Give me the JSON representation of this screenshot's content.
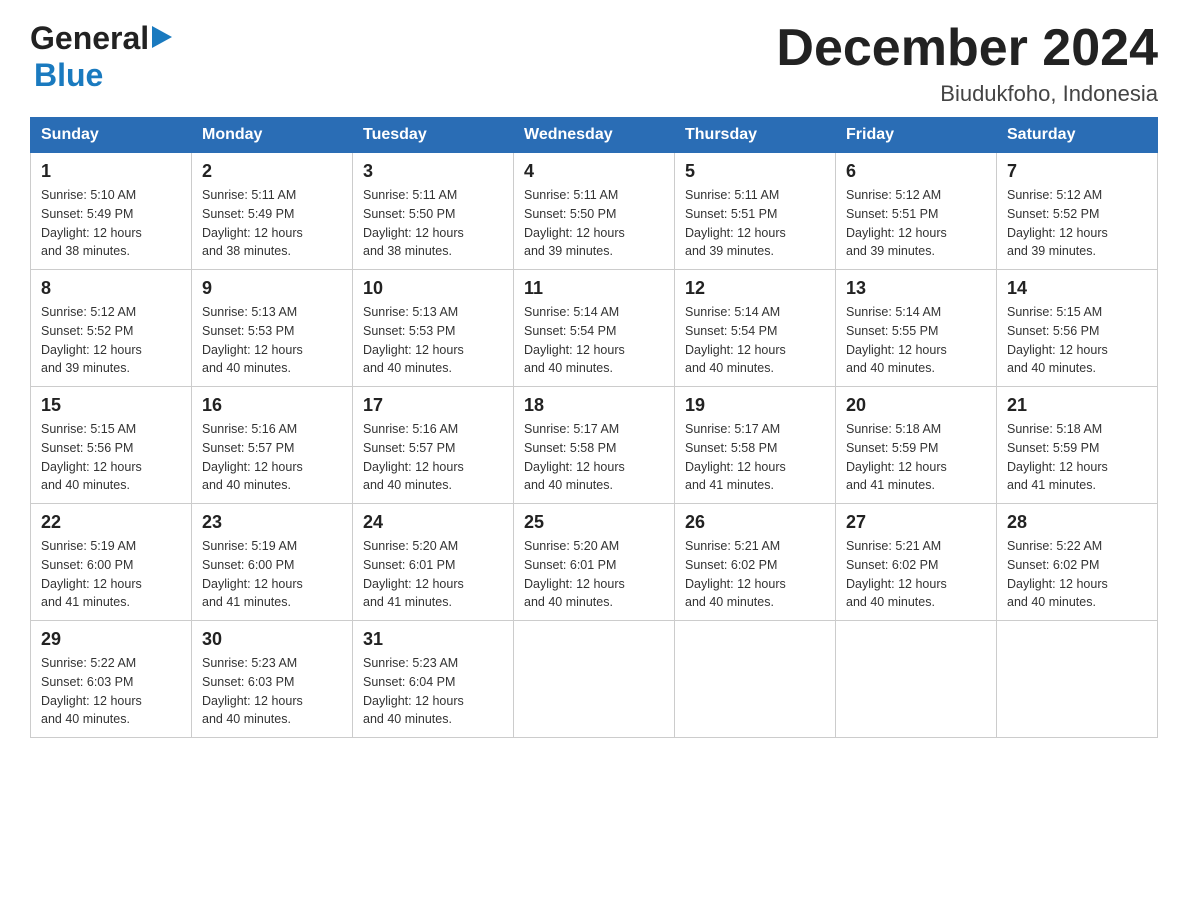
{
  "logo": {
    "line1": "General",
    "arrow": "▶",
    "line2": "Blue"
  },
  "title": {
    "month_year": "December 2024",
    "location": "Biudukfoho, Indonesia"
  },
  "days_of_week": [
    "Sunday",
    "Monday",
    "Tuesday",
    "Wednesday",
    "Thursday",
    "Friday",
    "Saturday"
  ],
  "weeks": [
    [
      {
        "day": "1",
        "sunrise": "5:10 AM",
        "sunset": "5:49 PM",
        "daylight": "12 hours and 38 minutes."
      },
      {
        "day": "2",
        "sunrise": "5:11 AM",
        "sunset": "5:49 PM",
        "daylight": "12 hours and 38 minutes."
      },
      {
        "day": "3",
        "sunrise": "5:11 AM",
        "sunset": "5:50 PM",
        "daylight": "12 hours and 38 minutes."
      },
      {
        "day": "4",
        "sunrise": "5:11 AM",
        "sunset": "5:50 PM",
        "daylight": "12 hours and 39 minutes."
      },
      {
        "day": "5",
        "sunrise": "5:11 AM",
        "sunset": "5:51 PM",
        "daylight": "12 hours and 39 minutes."
      },
      {
        "day": "6",
        "sunrise": "5:12 AM",
        "sunset": "5:51 PM",
        "daylight": "12 hours and 39 minutes."
      },
      {
        "day": "7",
        "sunrise": "5:12 AM",
        "sunset": "5:52 PM",
        "daylight": "12 hours and 39 minutes."
      }
    ],
    [
      {
        "day": "8",
        "sunrise": "5:12 AM",
        "sunset": "5:52 PM",
        "daylight": "12 hours and 39 minutes."
      },
      {
        "day": "9",
        "sunrise": "5:13 AM",
        "sunset": "5:53 PM",
        "daylight": "12 hours and 40 minutes."
      },
      {
        "day": "10",
        "sunrise": "5:13 AM",
        "sunset": "5:53 PM",
        "daylight": "12 hours and 40 minutes."
      },
      {
        "day": "11",
        "sunrise": "5:14 AM",
        "sunset": "5:54 PM",
        "daylight": "12 hours and 40 minutes."
      },
      {
        "day": "12",
        "sunrise": "5:14 AM",
        "sunset": "5:54 PM",
        "daylight": "12 hours and 40 minutes."
      },
      {
        "day": "13",
        "sunrise": "5:14 AM",
        "sunset": "5:55 PM",
        "daylight": "12 hours and 40 minutes."
      },
      {
        "day": "14",
        "sunrise": "5:15 AM",
        "sunset": "5:56 PM",
        "daylight": "12 hours and 40 minutes."
      }
    ],
    [
      {
        "day": "15",
        "sunrise": "5:15 AM",
        "sunset": "5:56 PM",
        "daylight": "12 hours and 40 minutes."
      },
      {
        "day": "16",
        "sunrise": "5:16 AM",
        "sunset": "5:57 PM",
        "daylight": "12 hours and 40 minutes."
      },
      {
        "day": "17",
        "sunrise": "5:16 AM",
        "sunset": "5:57 PM",
        "daylight": "12 hours and 40 minutes."
      },
      {
        "day": "18",
        "sunrise": "5:17 AM",
        "sunset": "5:58 PM",
        "daylight": "12 hours and 40 minutes."
      },
      {
        "day": "19",
        "sunrise": "5:17 AM",
        "sunset": "5:58 PM",
        "daylight": "12 hours and 41 minutes."
      },
      {
        "day": "20",
        "sunrise": "5:18 AM",
        "sunset": "5:59 PM",
        "daylight": "12 hours and 41 minutes."
      },
      {
        "day": "21",
        "sunrise": "5:18 AM",
        "sunset": "5:59 PM",
        "daylight": "12 hours and 41 minutes."
      }
    ],
    [
      {
        "day": "22",
        "sunrise": "5:19 AM",
        "sunset": "6:00 PM",
        "daylight": "12 hours and 41 minutes."
      },
      {
        "day": "23",
        "sunrise": "5:19 AM",
        "sunset": "6:00 PM",
        "daylight": "12 hours and 41 minutes."
      },
      {
        "day": "24",
        "sunrise": "5:20 AM",
        "sunset": "6:01 PM",
        "daylight": "12 hours and 41 minutes."
      },
      {
        "day": "25",
        "sunrise": "5:20 AM",
        "sunset": "6:01 PM",
        "daylight": "12 hours and 40 minutes."
      },
      {
        "day": "26",
        "sunrise": "5:21 AM",
        "sunset": "6:02 PM",
        "daylight": "12 hours and 40 minutes."
      },
      {
        "day": "27",
        "sunrise": "5:21 AM",
        "sunset": "6:02 PM",
        "daylight": "12 hours and 40 minutes."
      },
      {
        "day": "28",
        "sunrise": "5:22 AM",
        "sunset": "6:02 PM",
        "daylight": "12 hours and 40 minutes."
      }
    ],
    [
      {
        "day": "29",
        "sunrise": "5:22 AM",
        "sunset": "6:03 PM",
        "daylight": "12 hours and 40 minutes."
      },
      {
        "day": "30",
        "sunrise": "5:23 AM",
        "sunset": "6:03 PM",
        "daylight": "12 hours and 40 minutes."
      },
      {
        "day": "31",
        "sunrise": "5:23 AM",
        "sunset": "6:04 PM",
        "daylight": "12 hours and 40 minutes."
      },
      null,
      null,
      null,
      null
    ]
  ],
  "labels": {
    "sunrise": "Sunrise:",
    "sunset": "Sunset:",
    "daylight": "Daylight:"
  }
}
